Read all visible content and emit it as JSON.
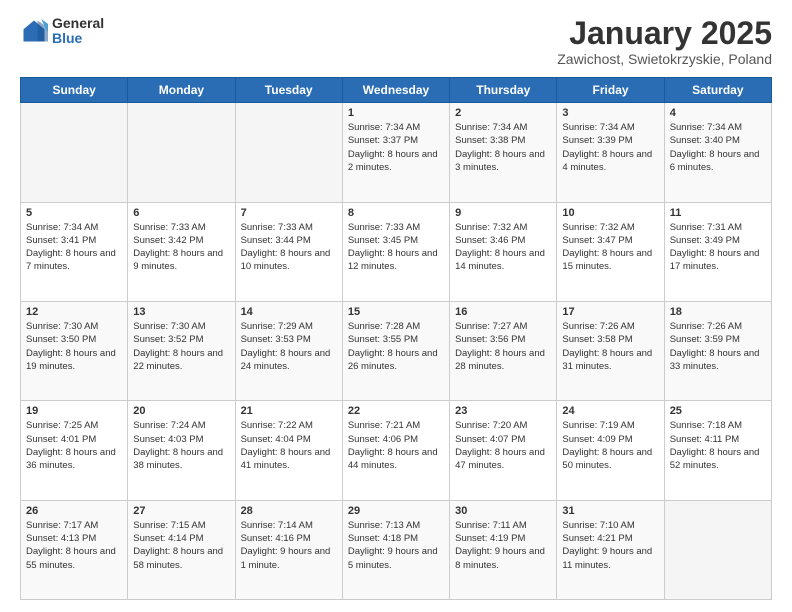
{
  "logo": {
    "general": "General",
    "blue": "Blue"
  },
  "title": "January 2025",
  "subtitle": "Zawichost, Swietokrzyskie, Poland",
  "headers": [
    "Sunday",
    "Monday",
    "Tuesday",
    "Wednesday",
    "Thursday",
    "Friday",
    "Saturday"
  ],
  "weeks": [
    [
      {
        "day": "",
        "info": ""
      },
      {
        "day": "",
        "info": ""
      },
      {
        "day": "",
        "info": ""
      },
      {
        "day": "1",
        "info": "Sunrise: 7:34 AM\nSunset: 3:37 PM\nDaylight: 8 hours and 2 minutes."
      },
      {
        "day": "2",
        "info": "Sunrise: 7:34 AM\nSunset: 3:38 PM\nDaylight: 8 hours and 3 minutes."
      },
      {
        "day": "3",
        "info": "Sunrise: 7:34 AM\nSunset: 3:39 PM\nDaylight: 8 hours and 4 minutes."
      },
      {
        "day": "4",
        "info": "Sunrise: 7:34 AM\nSunset: 3:40 PM\nDaylight: 8 hours and 6 minutes."
      }
    ],
    [
      {
        "day": "5",
        "info": "Sunrise: 7:34 AM\nSunset: 3:41 PM\nDaylight: 8 hours and 7 minutes."
      },
      {
        "day": "6",
        "info": "Sunrise: 7:33 AM\nSunset: 3:42 PM\nDaylight: 8 hours and 9 minutes."
      },
      {
        "day": "7",
        "info": "Sunrise: 7:33 AM\nSunset: 3:44 PM\nDaylight: 8 hours and 10 minutes."
      },
      {
        "day": "8",
        "info": "Sunrise: 7:33 AM\nSunset: 3:45 PM\nDaylight: 8 hours and 12 minutes."
      },
      {
        "day": "9",
        "info": "Sunrise: 7:32 AM\nSunset: 3:46 PM\nDaylight: 8 hours and 14 minutes."
      },
      {
        "day": "10",
        "info": "Sunrise: 7:32 AM\nSunset: 3:47 PM\nDaylight: 8 hours and 15 minutes."
      },
      {
        "day": "11",
        "info": "Sunrise: 7:31 AM\nSunset: 3:49 PM\nDaylight: 8 hours and 17 minutes."
      }
    ],
    [
      {
        "day": "12",
        "info": "Sunrise: 7:30 AM\nSunset: 3:50 PM\nDaylight: 8 hours and 19 minutes."
      },
      {
        "day": "13",
        "info": "Sunrise: 7:30 AM\nSunset: 3:52 PM\nDaylight: 8 hours and 22 minutes."
      },
      {
        "day": "14",
        "info": "Sunrise: 7:29 AM\nSunset: 3:53 PM\nDaylight: 8 hours and 24 minutes."
      },
      {
        "day": "15",
        "info": "Sunrise: 7:28 AM\nSunset: 3:55 PM\nDaylight: 8 hours and 26 minutes."
      },
      {
        "day": "16",
        "info": "Sunrise: 7:27 AM\nSunset: 3:56 PM\nDaylight: 8 hours and 28 minutes."
      },
      {
        "day": "17",
        "info": "Sunrise: 7:26 AM\nSunset: 3:58 PM\nDaylight: 8 hours and 31 minutes."
      },
      {
        "day": "18",
        "info": "Sunrise: 7:26 AM\nSunset: 3:59 PM\nDaylight: 8 hours and 33 minutes."
      }
    ],
    [
      {
        "day": "19",
        "info": "Sunrise: 7:25 AM\nSunset: 4:01 PM\nDaylight: 8 hours and 36 minutes."
      },
      {
        "day": "20",
        "info": "Sunrise: 7:24 AM\nSunset: 4:03 PM\nDaylight: 8 hours and 38 minutes."
      },
      {
        "day": "21",
        "info": "Sunrise: 7:22 AM\nSunset: 4:04 PM\nDaylight: 8 hours and 41 minutes."
      },
      {
        "day": "22",
        "info": "Sunrise: 7:21 AM\nSunset: 4:06 PM\nDaylight: 8 hours and 44 minutes."
      },
      {
        "day": "23",
        "info": "Sunrise: 7:20 AM\nSunset: 4:07 PM\nDaylight: 8 hours and 47 minutes."
      },
      {
        "day": "24",
        "info": "Sunrise: 7:19 AM\nSunset: 4:09 PM\nDaylight: 8 hours and 50 minutes."
      },
      {
        "day": "25",
        "info": "Sunrise: 7:18 AM\nSunset: 4:11 PM\nDaylight: 8 hours and 52 minutes."
      }
    ],
    [
      {
        "day": "26",
        "info": "Sunrise: 7:17 AM\nSunset: 4:13 PM\nDaylight: 8 hours and 55 minutes."
      },
      {
        "day": "27",
        "info": "Sunrise: 7:15 AM\nSunset: 4:14 PM\nDaylight: 8 hours and 58 minutes."
      },
      {
        "day": "28",
        "info": "Sunrise: 7:14 AM\nSunset: 4:16 PM\nDaylight: 9 hours and 1 minute."
      },
      {
        "day": "29",
        "info": "Sunrise: 7:13 AM\nSunset: 4:18 PM\nDaylight: 9 hours and 5 minutes."
      },
      {
        "day": "30",
        "info": "Sunrise: 7:11 AM\nSunset: 4:19 PM\nDaylight: 9 hours and 8 minutes."
      },
      {
        "day": "31",
        "info": "Sunrise: 7:10 AM\nSunset: 4:21 PM\nDaylight: 9 hours and 11 minutes."
      },
      {
        "day": "",
        "info": ""
      }
    ]
  ]
}
